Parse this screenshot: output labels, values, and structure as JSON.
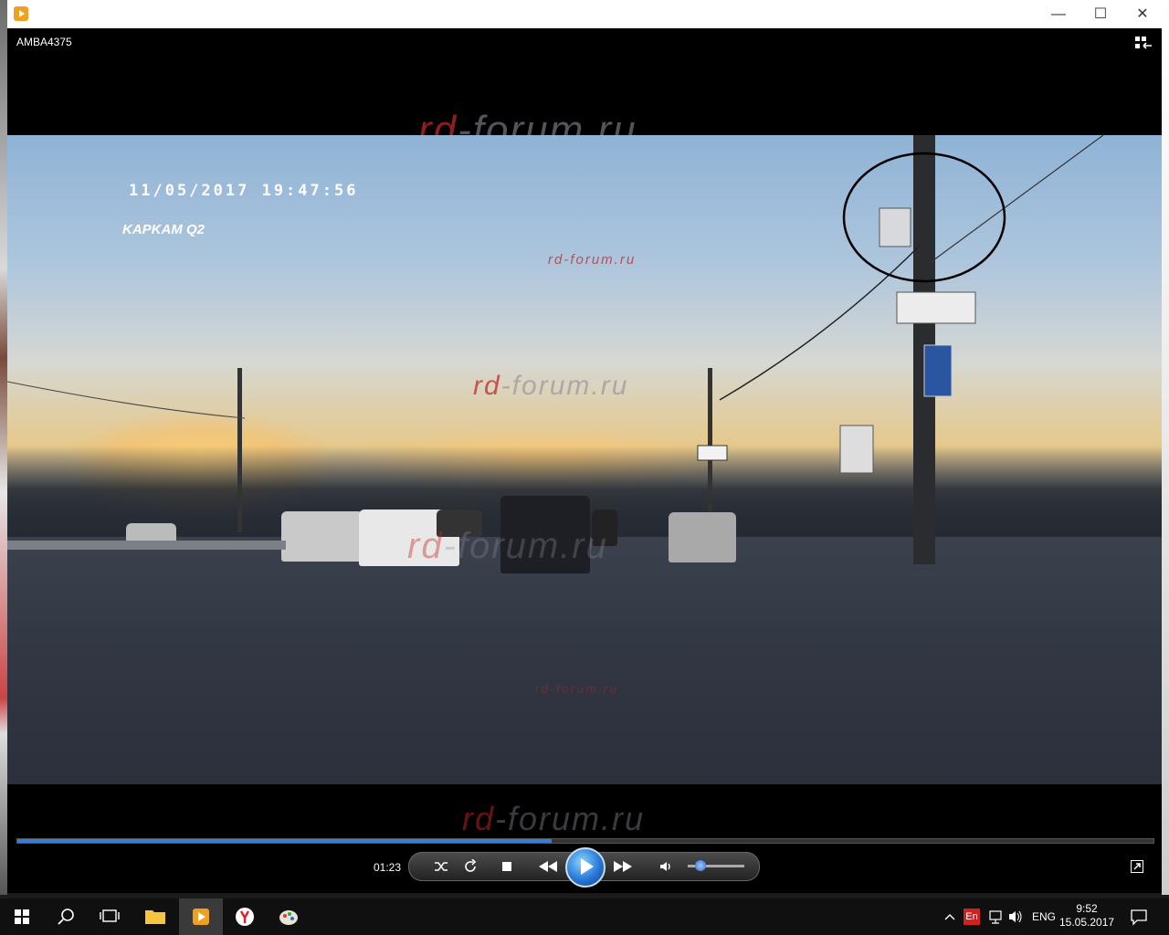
{
  "window": {
    "title": "AMBA4375",
    "controls": {
      "minimize": "—",
      "maximize": "☐",
      "close": "✕"
    }
  },
  "video": {
    "overlay_date": "11/05/2017 19:47:56",
    "overlay_model": "KAPKAM Q2",
    "watermark_text": "rd-forum.ru",
    "watermark_prefix": "rd",
    "watermark_suffix": "-forum.ru"
  },
  "player": {
    "elapsed": "01:23",
    "progress_fraction": 0.47,
    "volume_fraction": 0.15,
    "icons": [
      "shuffle-icon",
      "repeat-icon",
      "stop-icon",
      "previous-icon",
      "play-icon",
      "next-icon",
      "volume-icon"
    ]
  },
  "taskbar": {
    "items": [
      "windows-start-icon",
      "search-icon",
      "task-view-icon",
      "file-explorer-icon",
      "media-player-icon",
      "yandex-browser-icon",
      "paint-icon"
    ],
    "language_badge": "En",
    "language_label": "ENG",
    "time": "9:52",
    "date": "15.05.2017"
  },
  "colors": {
    "accent": "#3a7bd5",
    "watermark": "#be2828"
  }
}
